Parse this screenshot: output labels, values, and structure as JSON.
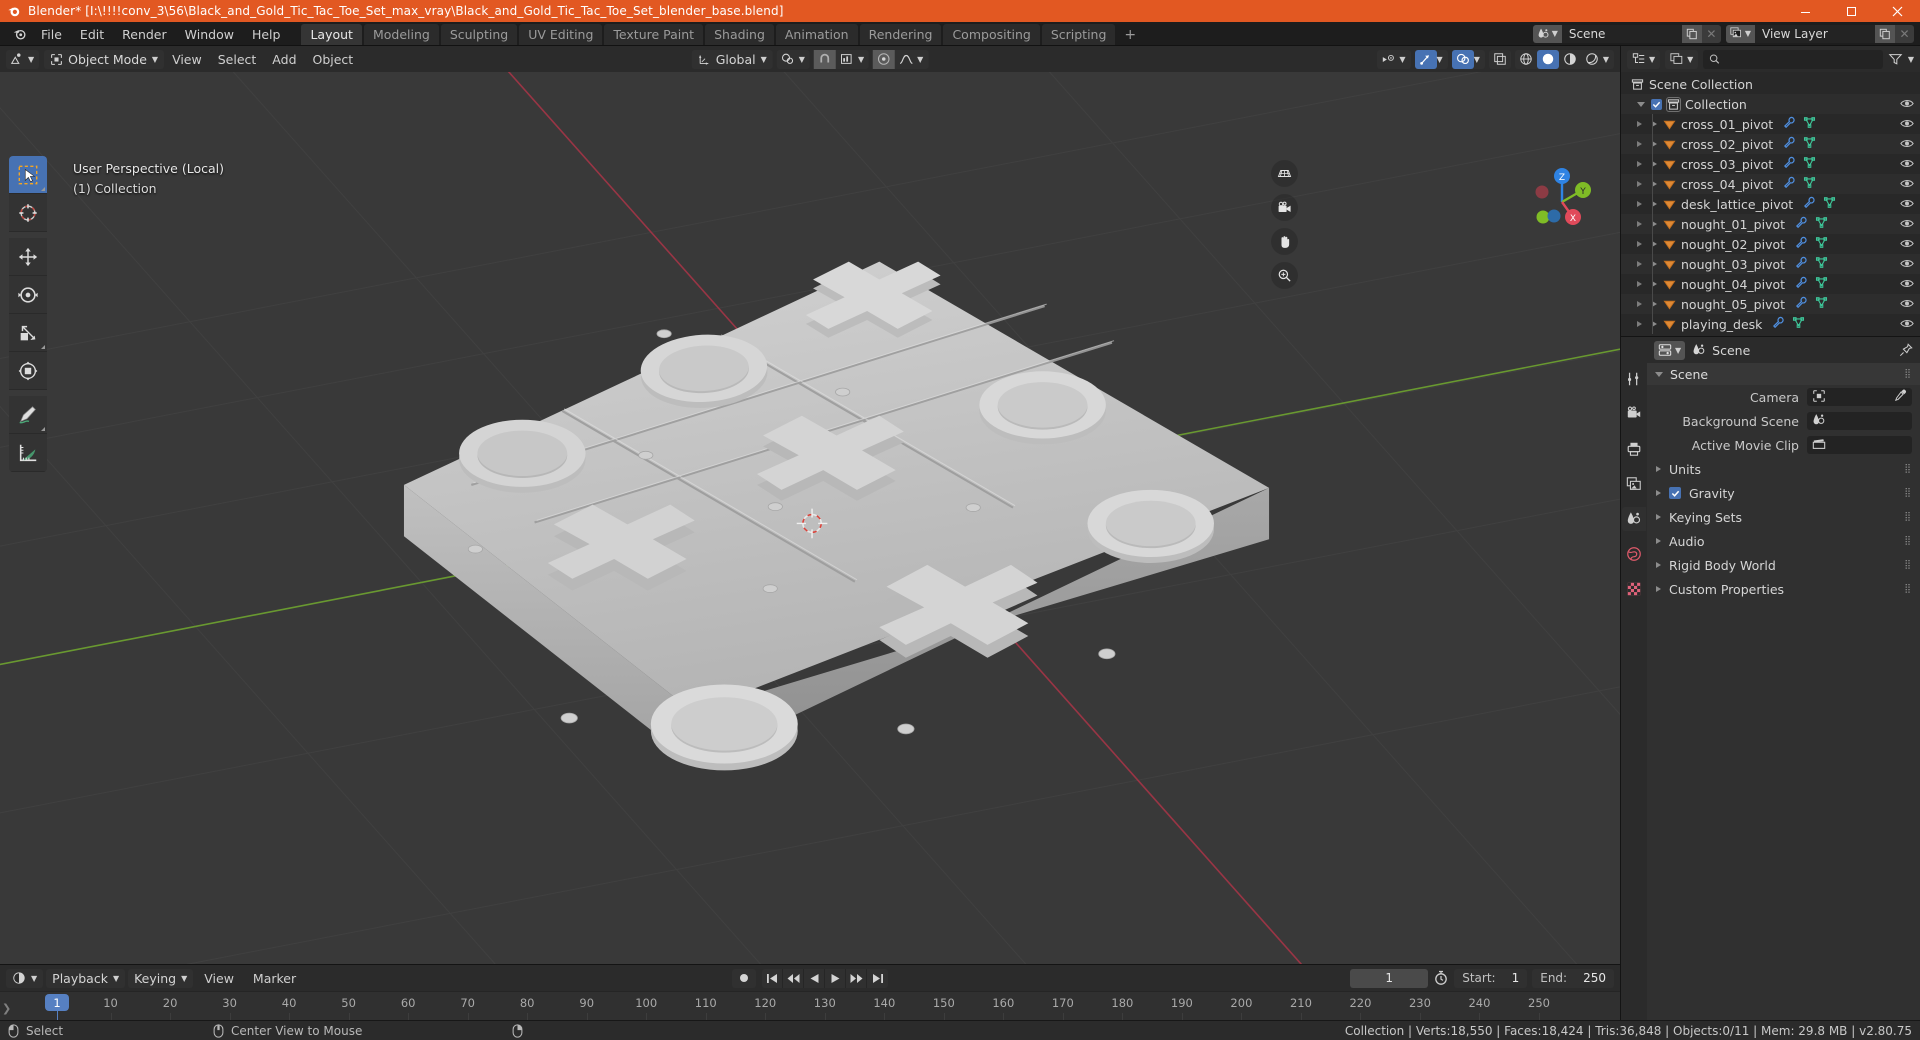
{
  "window": {
    "title": "Blender* [I:\\!!!!conv_3\\56\\Black_and_Gold_Tic_Tac_Toe_Set_max_vray\\Black_and_Gold_Tic_Tac_Toe_Set_blender_base.blend]",
    "minimize": "minimize-button",
    "maximize": "maximize-button",
    "close": "close-button",
    "accent": "#e25822"
  },
  "topbar": {
    "menus": [
      "File",
      "Edit",
      "Render",
      "Window",
      "Help"
    ],
    "workspaces": [
      {
        "label": "Layout",
        "active": true
      },
      {
        "label": "Modeling",
        "active": false
      },
      {
        "label": "Sculpting",
        "active": false
      },
      {
        "label": "UV Editing",
        "active": false
      },
      {
        "label": "Texture Paint",
        "active": false
      },
      {
        "label": "Shading",
        "active": false
      },
      {
        "label": "Animation",
        "active": false
      },
      {
        "label": "Rendering",
        "active": false
      },
      {
        "label": "Compositing",
        "active": false
      },
      {
        "label": "Scripting",
        "active": false
      }
    ],
    "add_workspace": "+",
    "scene_name": "Scene",
    "view_layer_name": "View Layer"
  },
  "viewport_header": {
    "mode": "Object Mode",
    "menus": [
      "View",
      "Select",
      "Add",
      "Object"
    ],
    "transform_orientation": "Global"
  },
  "viewport": {
    "overlay_line1": "User Perspective (Local)",
    "overlay_line2": "(1) Collection",
    "gizmo_axes": [
      "X",
      "Y",
      "Z"
    ],
    "nav_icons": [
      "grid-toggle-icon",
      "camera-view-icon",
      "pan-view-icon",
      "zoom-view-icon"
    ],
    "tools": [
      {
        "name": "tweak-select-box-tool",
        "active": true
      },
      {
        "name": "cursor-tool",
        "active": false
      },
      {
        "name": "move-tool",
        "active": false
      },
      {
        "name": "rotate-tool",
        "active": false
      },
      {
        "name": "scale-tool",
        "active": false
      },
      {
        "name": "transform-tool",
        "active": false
      },
      {
        "name": "annotate-tool",
        "active": false
      },
      {
        "name": "measure-tool",
        "active": false
      }
    ]
  },
  "outliner": {
    "search_placeholder": "",
    "rows": [
      {
        "label": "Scene Collection",
        "depth": 0,
        "type": "scene-collection",
        "disclosure": "none",
        "checkbox": false,
        "modifier": false,
        "mesh": false,
        "eye": false
      },
      {
        "label": "Collection",
        "depth": 1,
        "type": "collection",
        "disclosure": "open",
        "checkbox": true,
        "modifier": false,
        "mesh": false,
        "eye": true
      },
      {
        "label": "cross_01_pivot",
        "depth": 2,
        "type": "mesh-object",
        "disclosure": "closed",
        "checkbox": false,
        "modifier": true,
        "mesh": true,
        "eye": true
      },
      {
        "label": "cross_02_pivot",
        "depth": 2,
        "type": "mesh-object",
        "disclosure": "closed",
        "checkbox": false,
        "modifier": true,
        "mesh": true,
        "eye": true
      },
      {
        "label": "cross_03_pivot",
        "depth": 2,
        "type": "mesh-object",
        "disclosure": "closed",
        "checkbox": false,
        "modifier": true,
        "mesh": true,
        "eye": true
      },
      {
        "label": "cross_04_pivot",
        "depth": 2,
        "type": "mesh-object",
        "disclosure": "closed",
        "checkbox": false,
        "modifier": true,
        "mesh": true,
        "eye": true
      },
      {
        "label": "desk_lattice_pivot",
        "depth": 2,
        "type": "mesh-object",
        "disclosure": "closed",
        "checkbox": false,
        "modifier": true,
        "mesh": true,
        "eye": true
      },
      {
        "label": "nought_01_pivot",
        "depth": 2,
        "type": "mesh-object",
        "disclosure": "closed",
        "checkbox": false,
        "modifier": true,
        "mesh": true,
        "eye": true
      },
      {
        "label": "nought_02_pivot",
        "depth": 2,
        "type": "mesh-object",
        "disclosure": "closed",
        "checkbox": false,
        "modifier": true,
        "mesh": true,
        "eye": true
      },
      {
        "label": "nought_03_pivot",
        "depth": 2,
        "type": "mesh-object",
        "disclosure": "closed",
        "checkbox": false,
        "modifier": true,
        "mesh": true,
        "eye": true
      },
      {
        "label": "nought_04_pivot",
        "depth": 2,
        "type": "mesh-object",
        "disclosure": "closed",
        "checkbox": false,
        "modifier": true,
        "mesh": true,
        "eye": true
      },
      {
        "label": "nought_05_pivot",
        "depth": 2,
        "type": "mesh-object",
        "disclosure": "closed",
        "checkbox": false,
        "modifier": true,
        "mesh": true,
        "eye": true
      },
      {
        "label": "playing_desk",
        "depth": 2,
        "type": "mesh-object",
        "disclosure": "closed",
        "checkbox": false,
        "modifier": true,
        "mesh": true,
        "eye": true
      }
    ]
  },
  "properties": {
    "breadcrumb": "Scene",
    "panel_title": "Scene",
    "fields": [
      {
        "label": "Camera",
        "value": "",
        "icon": "camera-object-icon",
        "eyedropper": true
      },
      {
        "label": "Background Scene",
        "value": "",
        "icon": "scene-icon",
        "eyedropper": false
      },
      {
        "label": "Active Movie Clip",
        "value": "",
        "icon": "movie-clip-icon",
        "eyedropper": false
      }
    ],
    "sections": [
      {
        "label": "Units",
        "checkbox": false
      },
      {
        "label": "Gravity",
        "checkbox": true
      },
      {
        "label": "Keying Sets",
        "checkbox": false
      },
      {
        "label": "Audio",
        "checkbox": false
      },
      {
        "label": "Rigid Body World",
        "checkbox": false
      },
      {
        "label": "Custom Properties",
        "checkbox": false
      }
    ],
    "tabs": [
      {
        "name": "tool-tab",
        "active": false
      },
      {
        "name": "render-tab",
        "active": false
      },
      {
        "name": "output-tab",
        "active": false
      },
      {
        "name": "view-layer-tab",
        "active": false
      },
      {
        "name": "scene-tab",
        "active": true
      },
      {
        "name": "world-tab",
        "active": false
      },
      {
        "name": "texture-tab",
        "active": false
      }
    ]
  },
  "timeline": {
    "playback_label": "Playback",
    "keying_label": "Keying",
    "menus": [
      "View",
      "Marker"
    ],
    "current_frame": "1",
    "start_label": "Start:",
    "start_value": "1",
    "end_label": "End:",
    "end_value": "250",
    "ticks": [
      10,
      20,
      30,
      40,
      50,
      60,
      70,
      80,
      90,
      100,
      110,
      120,
      130,
      140,
      150,
      160,
      170,
      180,
      190,
      200,
      210,
      220,
      230,
      240,
      250
    ]
  },
  "statusbar": {
    "hint_select": "Select",
    "hint_center": "Center View to Mouse",
    "stats": "Collection | Verts:18,550 | Faces:18,424 | Tris:36,848 | Objects:0/11 | Mem: 29.8 MB | v2.80.75"
  }
}
